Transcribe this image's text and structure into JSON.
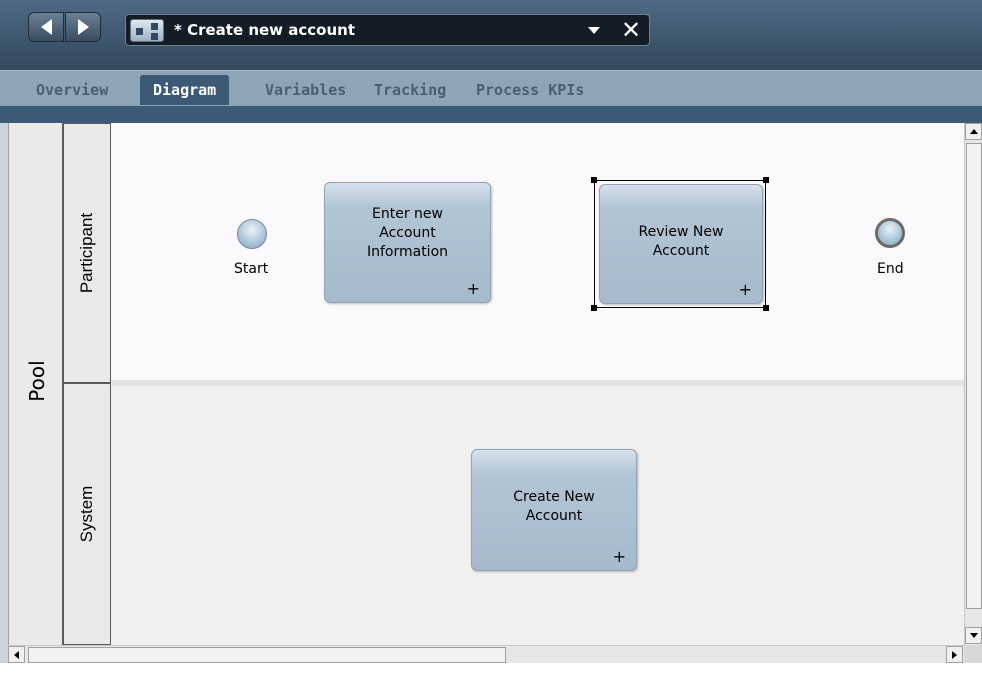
{
  "window": {
    "title": "* Create new account",
    "close_glyph": "✕"
  },
  "nav": {
    "back_icon": "back-arrow-icon",
    "forward_icon": "forward-arrow-icon"
  },
  "tabs": [
    {
      "label": "Overview",
      "active": false
    },
    {
      "label": "Diagram",
      "active": true
    },
    {
      "label": "Variables",
      "active": false
    },
    {
      "label": "Tracking",
      "active": false
    },
    {
      "label": "Process KPIs",
      "active": false
    }
  ],
  "diagram": {
    "pool": {
      "label": "Pool"
    },
    "lanes": [
      {
        "label": "Participant"
      },
      {
        "label": "System"
      }
    ],
    "start_event": {
      "label": "Start"
    },
    "end_event": {
      "label": "End"
    },
    "tasks": [
      {
        "label": "Enter new Account Information",
        "lines": [
          "Enter new",
          "Account",
          "Information"
        ],
        "expand": "+"
      },
      {
        "label": "Review New Account",
        "lines": [
          "Review New",
          "Account"
        ],
        "expand": "+",
        "selected": true
      },
      {
        "label": "Create New Account",
        "lines": [
          "Create New",
          "Account"
        ],
        "expand": "+"
      }
    ]
  },
  "colors": {
    "title_bar": "#3d566c",
    "tab_bar": "#8ea5b8",
    "active_tab": "#3c5a75",
    "task_fill": "#a6bacb",
    "lane_system_bg": "#f2f0ef"
  }
}
